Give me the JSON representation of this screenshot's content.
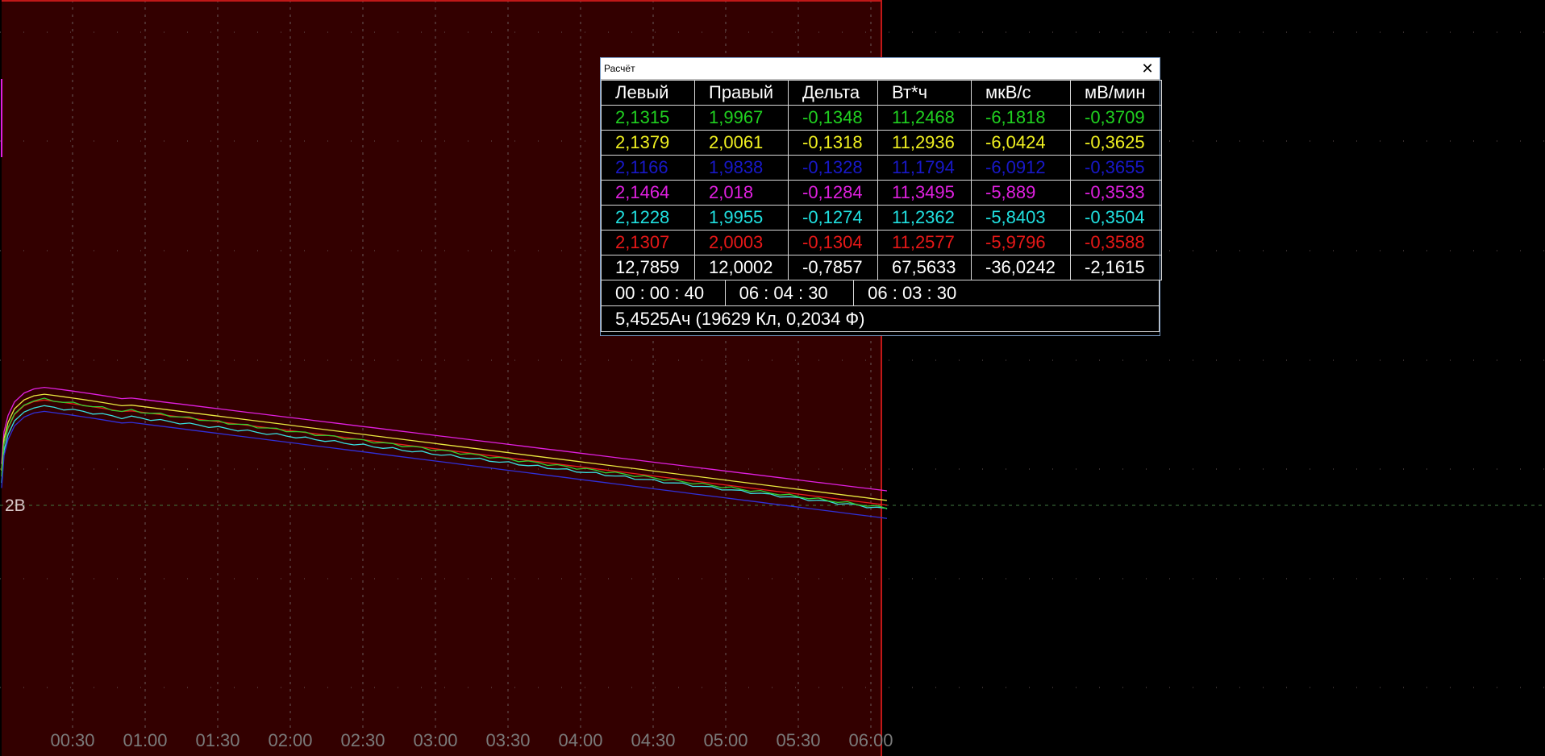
{
  "chart_data": {
    "type": "line",
    "y_marker_label": "2В",
    "x_ticks": [
      "00:30",
      "01:00",
      "01:30",
      "02:00",
      "02:30",
      "03:00",
      "03:30",
      "04:00",
      "04:30",
      "05:00",
      "05:30",
      "06:00"
    ],
    "colors": {
      "background": "#000000",
      "selection": "#330000",
      "selection_border": "#c01818",
      "grid": "#6a5a5a",
      "tick_text": "#7a7a7a",
      "marker_line": "#3f7a3f",
      "marker_text": "#d8c8c8"
    },
    "series": [
      {
        "color": "#e020e0",
        "start": 2.1464,
        "end": 2.018
      },
      {
        "color": "#e8e840",
        "start": 2.1379,
        "end": 2.0061
      },
      {
        "color": "#e81c1c",
        "start": 2.1307,
        "end": 2.0003
      },
      {
        "color": "#38e0e0",
        "start": 2.1228,
        "end": 1.9955
      },
      {
        "color": "#30d030",
        "start": 2.1315,
        "end": 1.9967
      },
      {
        "color": "#3030d8",
        "start": 2.1166,
        "end": 1.9838
      }
    ]
  },
  "calc_window": {
    "title": "Расчёт",
    "close_glyph": "✕",
    "headers": [
      "Левый",
      "Правый",
      "Дельта",
      "Вт*ч",
      "мкВ/с",
      "мВ/мин"
    ],
    "rows": [
      {
        "color": "#20d020",
        "cells": [
          "2,1315",
          "1,9967",
          "-0,1348",
          "11,2468",
          "-6,1818",
          "-0,3709"
        ]
      },
      {
        "color": "#f0f020",
        "cells": [
          "2,1379",
          "2,0061",
          "-0,1318",
          "11,2936",
          "-6,0424",
          "-0,3625"
        ]
      },
      {
        "color": "#1818c8",
        "cells": [
          "2,1166",
          "1,9838",
          "-0,1328",
          "11,1794",
          "-6,0912",
          "-0,3655"
        ]
      },
      {
        "color": "#e020e0",
        "cells": [
          "2,1464",
          "2,018",
          "-0,1284",
          "11,3495",
          "-5,889",
          "-0,3533"
        ]
      },
      {
        "color": "#20e0e0",
        "cells": [
          "2,1228",
          "1,9955",
          "-0,1274",
          "11,2362",
          "-5,8403",
          "-0,3504"
        ]
      },
      {
        "color": "#e81818",
        "cells": [
          "2,1307",
          "2,0003",
          "-0,1304",
          "11,2577",
          "-5,9796",
          "-0,3588"
        ]
      },
      {
        "color": "#ffffff",
        "cells": [
          "12,7859",
          "12,0002",
          "-0,7857",
          "67,5633",
          "-36,0242",
          "-2,1615"
        ]
      }
    ],
    "times": [
      "00 : 00 : 40",
      "06 : 04 : 30",
      "06 : 03 : 30"
    ],
    "summary": "5,4525Ач (19629 Кл, 0,2034 Ф)"
  }
}
